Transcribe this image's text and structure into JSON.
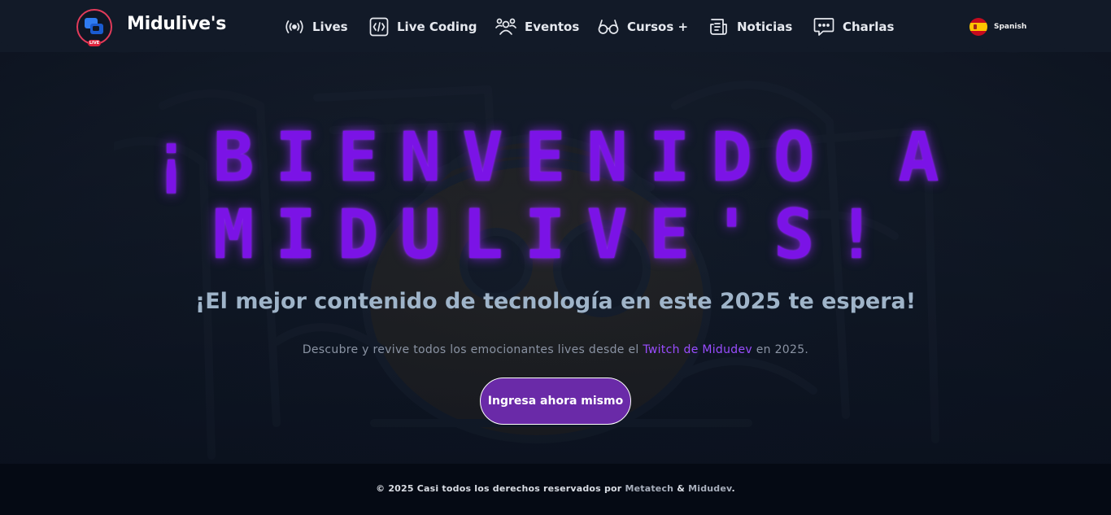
{
  "brand": {
    "name": "Midulive's",
    "live_badge": "LIVE"
  },
  "nav": {
    "items": [
      {
        "label": "Lives",
        "icon": "broadcast-icon"
      },
      {
        "label": "Live Coding",
        "icon": "code-icon"
      },
      {
        "label": "Eventos",
        "icon": "users-icon"
      },
      {
        "label": "Cursos +",
        "icon": "glasses-icon"
      },
      {
        "label": "Noticias",
        "icon": "newspaper-icon"
      },
      {
        "label": "Charlas",
        "icon": "chat-bubble-icon"
      }
    ]
  },
  "language": {
    "label": "Spanish",
    "flag": "spain-flag-icon"
  },
  "hero": {
    "title_line1": "¡Bienvenido a",
    "title_line2": "Midulive's!",
    "subtitle": "¡El mejor contenido de tecnología en este 2025 te espera!",
    "description_before": "Descubre y revive todos los emocionantes lives desde el",
    "description_link": "Twitch de Midudev",
    "description_after": "en 2025.",
    "cta_label": "Ingresa ahora mismo"
  },
  "footer": {
    "text_before": "© 2025 Casi todos los derechos reservados por",
    "link1": "Metatech",
    "ampersand": "&",
    "link2": "Midudev",
    "period": "."
  },
  "colors": {
    "title_purple": "#7b13e6",
    "link_purple": "#9a4dff",
    "cta_bg": "#6a2aa8",
    "subtitle": "#9fb4c9",
    "header_bg": "#121a28"
  }
}
